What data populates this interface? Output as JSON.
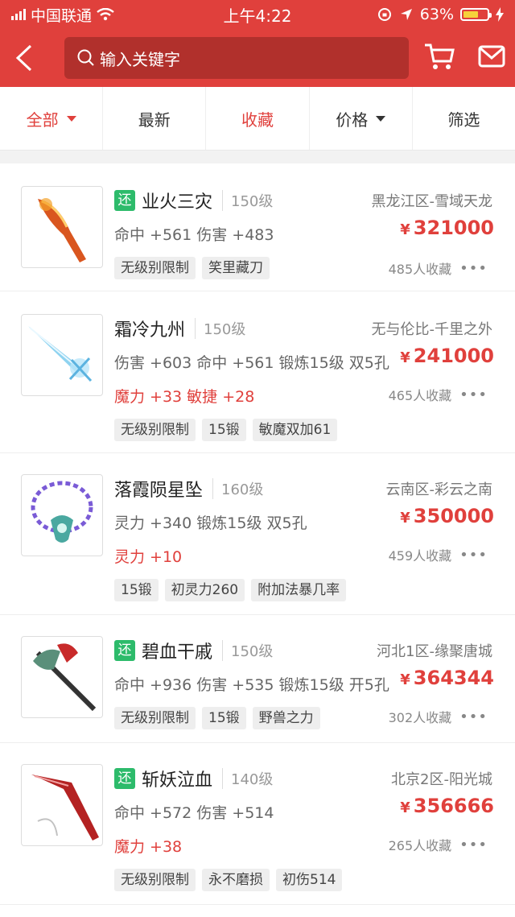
{
  "status_bar": {
    "carrier": "中国联通",
    "time": "上午4:22",
    "battery": "63%",
    "battery_level": 0.63
  },
  "header": {
    "search_placeholder": "输入关键字"
  },
  "tabs": [
    {
      "label": "全部",
      "active": true
    },
    {
      "label": "最新"
    },
    {
      "label": "收藏",
      "active_color": true
    },
    {
      "label": "价格"
    },
    {
      "label": "筛选"
    }
  ],
  "items": [
    {
      "returnable": "还",
      "name": "业火三灾",
      "level": "150级",
      "server": "黑龙江区-雪域天龙",
      "attrs": "命中 +561 伤害 +483",
      "attrs_red": "",
      "price_symbol": "¥",
      "price": "321000",
      "favs": "485人收藏",
      "chips": [
        "无级别限制",
        "笑里藏刀"
      ]
    },
    {
      "returnable": "",
      "name": "霜冷九州",
      "level": "150级",
      "server": "无与伦比-千里之外",
      "attrs": "伤害 +603 命中 +561 锻炼15级 双5孔",
      "attrs_red": "魔力 +33 敏捷 +28",
      "price_symbol": "¥",
      "price": "241000",
      "favs": "465人收藏",
      "chips": [
        "无级别限制",
        "15锻",
        "敏魔双加61"
      ]
    },
    {
      "returnable": "",
      "name": "落霞陨星坠",
      "level": "160级",
      "server": "云南区-彩云之南",
      "attrs": "灵力 +340 锻炼15级 双5孔",
      "attrs_red": "灵力 +10",
      "price_symbol": "¥",
      "price": "350000",
      "favs": "459人收藏",
      "chips": [
        "15锻",
        "初灵力260",
        "附加法暴几率"
      ]
    },
    {
      "returnable": "还",
      "name": "碧血干戚",
      "level": "150级",
      "server": "河北1区-缘聚唐城",
      "attrs": "命中 +936 伤害 +535 锻炼15级 开5孔",
      "attrs_red": "",
      "price_symbol": "¥",
      "price": "364344",
      "favs": "302人收藏",
      "chips": [
        "无级别限制",
        "15锻",
        "野兽之力"
      ]
    },
    {
      "returnable": "还",
      "name": "斩妖泣血",
      "level": "140级",
      "server": "北京2区-阳光城",
      "attrs": "命中 +572 伤害 +514",
      "attrs_red": "魔力 +38",
      "price_symbol": "¥",
      "price": "356666",
      "favs": "265人收藏",
      "chips": [
        "无级别限制",
        "永不磨损",
        "初伤514"
      ]
    }
  ],
  "colors": {
    "brand": "#e0403c",
    "tag_green": "#2dbb6b"
  }
}
